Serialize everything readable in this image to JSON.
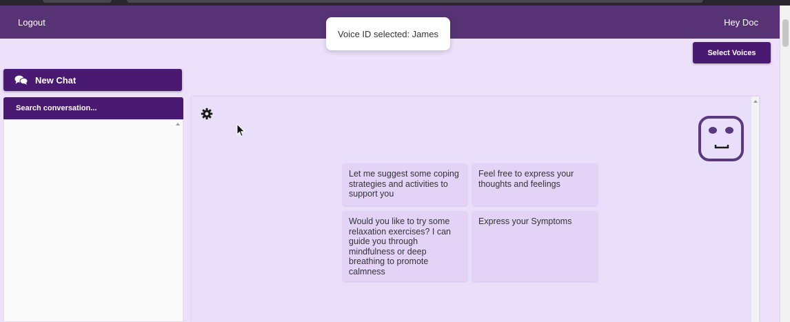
{
  "header": {
    "logout_label": "Logout",
    "greeting": "Hey Doc",
    "bg_color": "#573376"
  },
  "toast": {
    "message": "Voice ID selected: James"
  },
  "toolbar": {
    "select_voices_label": "Select Voices"
  },
  "sidebar": {
    "new_chat_label": "New Chat",
    "search_placeholder": "Search conversation..."
  },
  "suggestions": [
    "Let me suggest some coping strategies and activities to support you",
    "Feel free to express your thoughts and feelings",
    "Would you like to try some relaxation exercises? I can guide you through mindfulness or deep breathing to promote calmness",
    "Express your Symptoms"
  ],
  "icons": {
    "chat": "chat-bubbles-icon",
    "settings": "gear-icon",
    "bot": "robot-face-icon",
    "cursor": "mouse-cursor-icon"
  },
  "colors": {
    "accent": "#4a1a72",
    "page_bg": "#ece0fb",
    "card_bg": "#e3d3f7"
  }
}
